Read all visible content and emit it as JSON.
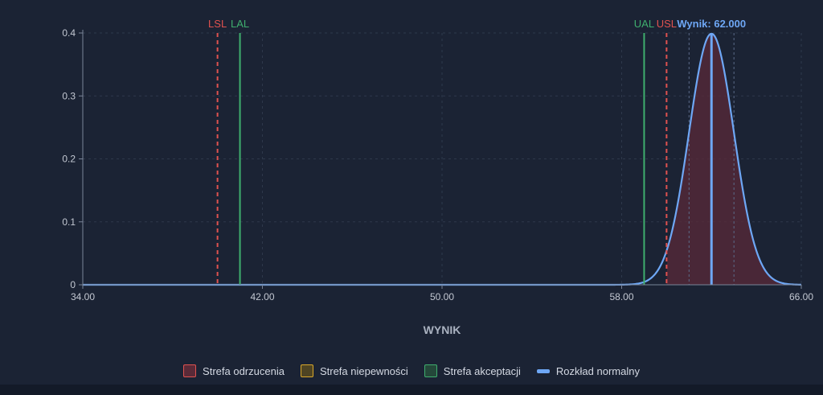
{
  "chart_data": {
    "type": "line",
    "title": "",
    "xlabel": "WYNIK",
    "ylabel": "",
    "xlim": [
      34,
      66
    ],
    "ylim": [
      0,
      0.4
    ],
    "x_ticks": [
      "34.00",
      "42.00",
      "50.00",
      "58.00",
      "66.00"
    ],
    "x_tick_values": [
      34,
      42,
      50,
      58,
      66
    ],
    "y_ticks": [
      "0",
      "0.1",
      "0.2",
      "0.3",
      "0.4"
    ],
    "y_tick_values": [
      0,
      0.1,
      0.2,
      0.3,
      0.4
    ],
    "grid": true,
    "distribution": {
      "name": "Rozkład normalny",
      "mean": 62.0,
      "sd": 1.0
    },
    "result": {
      "label": "Wynik: 62.000",
      "value": 62.0
    },
    "limits": [
      {
        "label": "LSL",
        "value": 40.0,
        "kind": "spec",
        "color": "#e0524f"
      },
      {
        "label": "LAL",
        "value": 41.0,
        "kind": "acceptance",
        "color": "#3fae6e"
      },
      {
        "label": "UAL",
        "value": 59.0,
        "kind": "acceptance",
        "color": "#3fae6e"
      },
      {
        "label": "USL",
        "value": 60.0,
        "kind": "spec",
        "color": "#e0524f"
      }
    ],
    "sigma_markers": [
      61.0,
      63.0
    ],
    "legend": {
      "placement": "bottom",
      "items": [
        {
          "label": "Strefa odrzucenia",
          "color": "#e0524f",
          "kind": "area"
        },
        {
          "label": "Strefa niepewności",
          "color": "#d9a82b",
          "kind": "area"
        },
        {
          "label": "Strefa akceptacji",
          "color": "#3fae6e",
          "kind": "area"
        },
        {
          "label": "Rozkład normalny",
          "color": "#6ea7f5",
          "kind": "line"
        }
      ]
    },
    "colors": {
      "background": "#1b2334",
      "axis": "#7a8498",
      "grid": "#2e384b",
      "tick_text": "#c3c8d2",
      "curve": "#6ea7f5",
      "reject_fill": "#5a2a38"
    }
  }
}
